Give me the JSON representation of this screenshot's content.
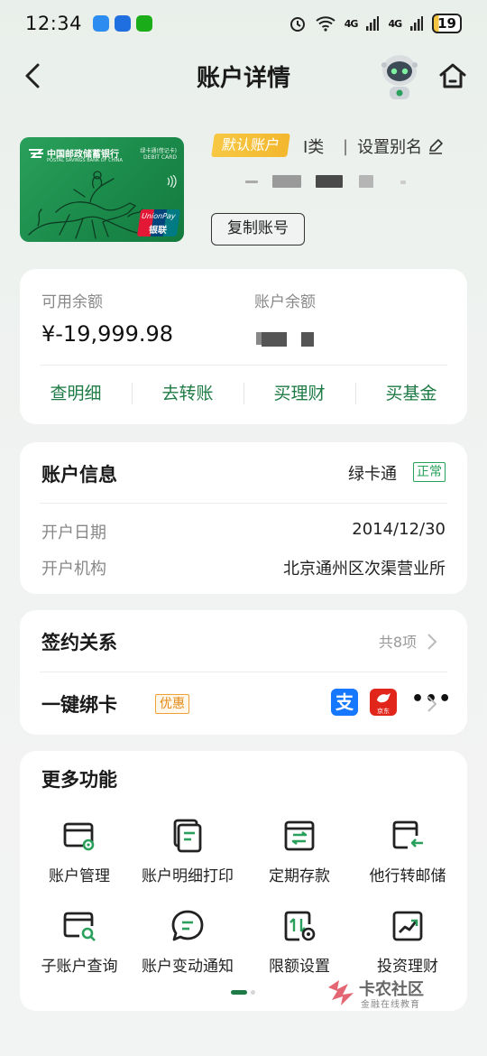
{
  "status_bar": {
    "time": "12:34",
    "signal_1": "4G",
    "signal_2": "4G",
    "battery": "19"
  },
  "nav": {
    "title": "账户详情"
  },
  "card": {
    "bank_name": "中国邮政储蓄银行",
    "bank_name_en": "POSTAL SAVINGS BANK OF CHINA",
    "card_type": "绿卡通(借记卡) DEBIT CARD",
    "unionpay_en": "UnionPay",
    "unionpay_cn": "银联",
    "default_badge": "默认账户",
    "account_class": "I类",
    "alias_label": "设置别名",
    "copy_button": "复制账号"
  },
  "balances": {
    "available_label": "可用余额",
    "available_value": "¥-19,999.98",
    "account_label": "账户余额",
    "quick_actions": [
      "查明细",
      "去转账",
      "买理财",
      "买基金"
    ]
  },
  "account_info": {
    "title": "账户信息",
    "account_type": "绿卡通",
    "status": "正常",
    "rows": [
      {
        "label": "开户日期",
        "value": "2014/12/30"
      },
      {
        "label": "开户机构",
        "value": "北京通州区次渠营业所"
      }
    ]
  },
  "sign": {
    "title": "签约关系",
    "count": "共8项",
    "bind_title": "一键绑卡",
    "promo": "优惠",
    "alipay_glyph": "支",
    "jd_label": "京东",
    "more": "•••"
  },
  "more_functions": {
    "title": "更多功能",
    "items": [
      {
        "label": "账户管理",
        "icon": "account-manage-icon"
      },
      {
        "label": "账户明细打印",
        "icon": "print-detail-icon"
      },
      {
        "label": "定期存款",
        "icon": "fixed-deposit-icon"
      },
      {
        "label": "他行转邮储",
        "icon": "transfer-in-icon"
      },
      {
        "label": "子账户查询",
        "icon": "sub-account-search-icon"
      },
      {
        "label": "账户变动通知",
        "icon": "change-notice-icon"
      },
      {
        "label": "限额设置",
        "icon": "limit-settings-icon"
      },
      {
        "label": "投资理财",
        "icon": "investment-icon"
      }
    ]
  },
  "watermark": {
    "title": "卡农社区",
    "subtitle": "金融在线教育"
  },
  "colors": {
    "brand_green": "#1e7b45",
    "badge_yellow": "#f5c038",
    "status_green": "#27a05a",
    "promo_orange": "#e58a17"
  }
}
